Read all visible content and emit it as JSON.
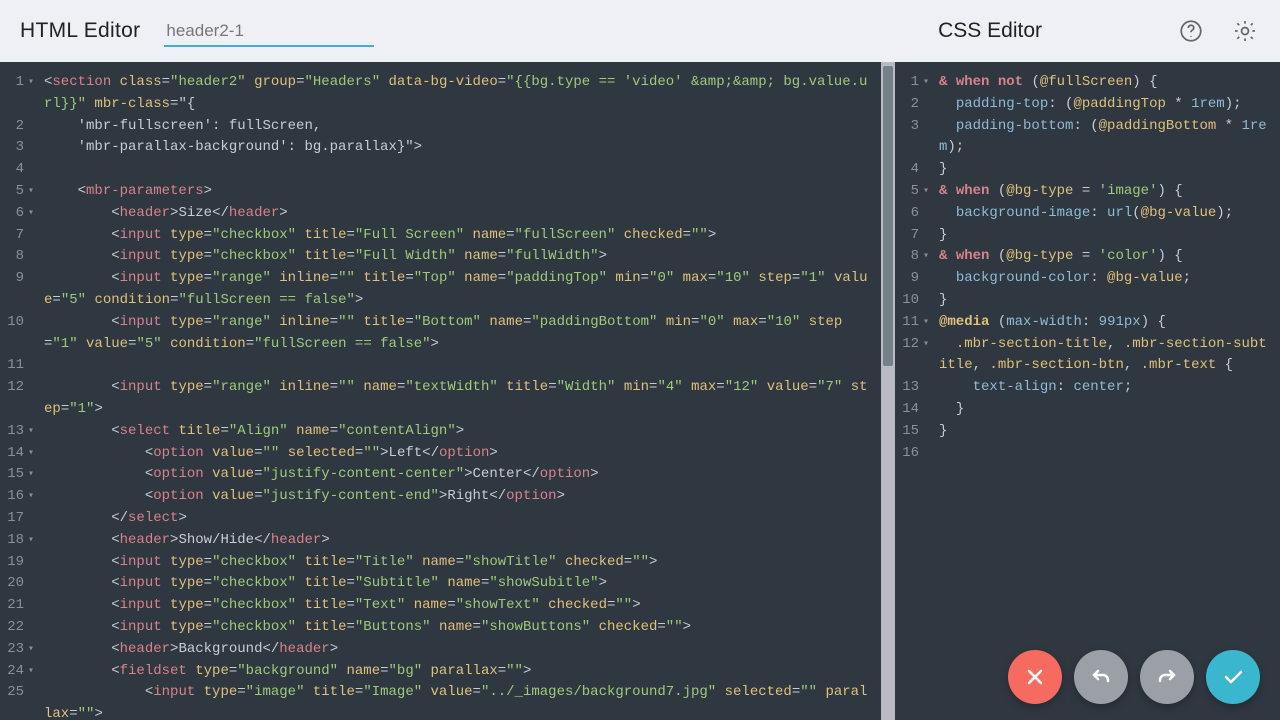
{
  "toolbar": {
    "html_title": "HTML Editor",
    "css_title": "CSS Editor",
    "tab_name": "header2-1"
  },
  "icons": {
    "help": "help-icon",
    "settings": "gear-icon",
    "close": "close-icon",
    "undo": "undo-icon",
    "redo": "redo-icon",
    "accept": "check-icon"
  },
  "html_gutter": [
    {
      "n": "1",
      "fold": true
    },
    {
      "n": ""
    },
    {
      "n": "2"
    },
    {
      "n": "3"
    },
    {
      "n": "4"
    },
    {
      "n": "5",
      "fold": true
    },
    {
      "n": "6",
      "fold": true
    },
    {
      "n": "7"
    },
    {
      "n": "8"
    },
    {
      "n": "9"
    },
    {
      "n": ""
    },
    {
      "n": "10"
    },
    {
      "n": ""
    },
    {
      "n": "11"
    },
    {
      "n": "12"
    },
    {
      "n": ""
    },
    {
      "n": "13",
      "fold": true
    },
    {
      "n": "14",
      "fold": true
    },
    {
      "n": "15",
      "fold": true
    },
    {
      "n": "16",
      "fold": true
    },
    {
      "n": "17"
    },
    {
      "n": "18",
      "fold": true
    },
    {
      "n": "19"
    },
    {
      "n": "20"
    },
    {
      "n": "21"
    },
    {
      "n": "22"
    },
    {
      "n": "23",
      "fold": true
    },
    {
      "n": "24",
      "fold": true
    },
    {
      "n": "25"
    },
    {
      "n": ""
    }
  ],
  "css_gutter": [
    {
      "n": "1",
      "fold": true
    },
    {
      "n": "2"
    },
    {
      "n": "3"
    },
    {
      "n": ""
    },
    {
      "n": "4"
    },
    {
      "n": "5",
      "fold": true
    },
    {
      "n": "6"
    },
    {
      "n": "7"
    },
    {
      "n": "8",
      "fold": true
    },
    {
      "n": "9"
    },
    {
      "n": "10"
    },
    {
      "n": "11",
      "fold": true
    },
    {
      "n": "12",
      "fold": true
    },
    {
      "n": ""
    },
    {
      "n": "13"
    },
    {
      "n": "14"
    },
    {
      "n": "15"
    },
    {
      "n": "16"
    }
  ],
  "html_code": [
    "<section class=\"header2\" group=\"Headers\" data-bg-video=\"{{bg.type == 'video' &amp;&amp; bg.value.url}}\" mbr-class=\"{",
    "    'mbr-fullscreen': fullScreen,",
    "    'mbr-parallax-background': bg.parallax}\">",
    "",
    "    <mbr-parameters>",
    "        <header>Size</header>",
    "        <input type=\"checkbox\" title=\"Full Screen\" name=\"fullScreen\" checked=\"\">",
    "        <input type=\"checkbox\" title=\"Full Width\" name=\"fullWidth\">",
    "        <input type=\"range\" inline=\"\" title=\"Top\" name=\"paddingTop\" min=\"0\" max=\"10\" step=\"1\" value=\"5\" condition=\"fullScreen == false\">",
    "        <input type=\"range\" inline=\"\" title=\"Bottom\" name=\"paddingBottom\" min=\"0\" max=\"10\" step=\"1\" value=\"5\" condition=\"fullScreen == false\">",
    "",
    "        <input type=\"range\" inline=\"\" name=\"textWidth\" title=\"Width\" min=\"4\" max=\"12\" value=\"7\" step=\"1\">",
    "        <select title=\"Align\" name=\"contentAlign\">",
    "            <option value=\"\" selected=\"\">Left</option>",
    "            <option value=\"justify-content-center\">Center</option>",
    "            <option value=\"justify-content-end\">Right</option>",
    "        </select>",
    "        <header>Show/Hide</header>",
    "        <input type=\"checkbox\" title=\"Title\" name=\"showTitle\" checked=\"\">",
    "        <input type=\"checkbox\" title=\"Subtitle\" name=\"showSubitle\">",
    "        <input type=\"checkbox\" title=\"Text\" name=\"showText\" checked=\"\">",
    "        <input type=\"checkbox\" title=\"Buttons\" name=\"showButtons\" checked=\"\">",
    "        <header>Background</header>",
    "        <fieldset type=\"background\" name=\"bg\" parallax=\"\">",
    "            <input type=\"image\" title=\"Image\" value=\"../_images/background7.jpg\" selected=\"\" parallax=\"\">"
  ],
  "css_code": [
    "& when not (@fullScreen) {",
    "  padding-top: (@paddingTop * 1rem);",
    "  padding-bottom: (@paddingBottom * 1rem);",
    "}",
    "& when (@bg-type = 'image') {",
    "  background-image: url(@bg-value);",
    "}",
    "& when (@bg-type = 'color') {",
    "  background-color: @bg-value;",
    "}",
    "@media (max-width: 991px) {",
    "  .mbr-section-title, .mbr-section-subtitle, .mbr-section-btn, .mbr-text {",
    "    text-align: center;",
    "  }",
    "}",
    ""
  ]
}
